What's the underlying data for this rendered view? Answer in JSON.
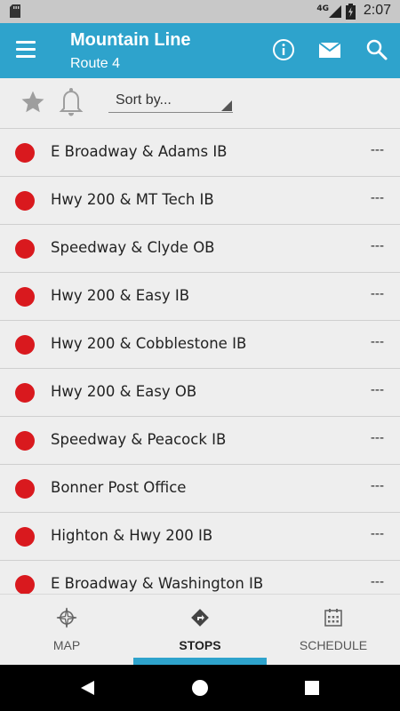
{
  "status_bar": {
    "time": "2:07",
    "network": "4G"
  },
  "app_bar": {
    "title": "Mountain Line",
    "subtitle": "Route 4"
  },
  "toolbar": {
    "sort_label": "Sort by..."
  },
  "stops": [
    {
      "name": "E Broadway & Adams IB",
      "eta": "---"
    },
    {
      "name": "Hwy 200 & MT Tech IB",
      "eta": "---"
    },
    {
      "name": "Speedway & Clyde OB",
      "eta": "---"
    },
    {
      "name": "Hwy 200 & Easy IB",
      "eta": "---"
    },
    {
      "name": "Hwy 200 & Cobblestone IB",
      "eta": "---"
    },
    {
      "name": "Hwy 200 & Easy OB",
      "eta": "---"
    },
    {
      "name": "Speedway & Peacock IB",
      "eta": "---"
    },
    {
      "name": "Bonner Post Office",
      "eta": "---"
    },
    {
      "name": "Highton & Hwy 200 IB",
      "eta": "---"
    },
    {
      "name": "E Broadway & Washington IB",
      "eta": "---"
    }
  ],
  "bottom_nav": {
    "map": "MAP",
    "stops": "STOPS",
    "schedule": "SCHEDULE",
    "active": "stops"
  },
  "colors": {
    "accent": "#2ea3cc",
    "stop_dot": "#d9191e"
  }
}
